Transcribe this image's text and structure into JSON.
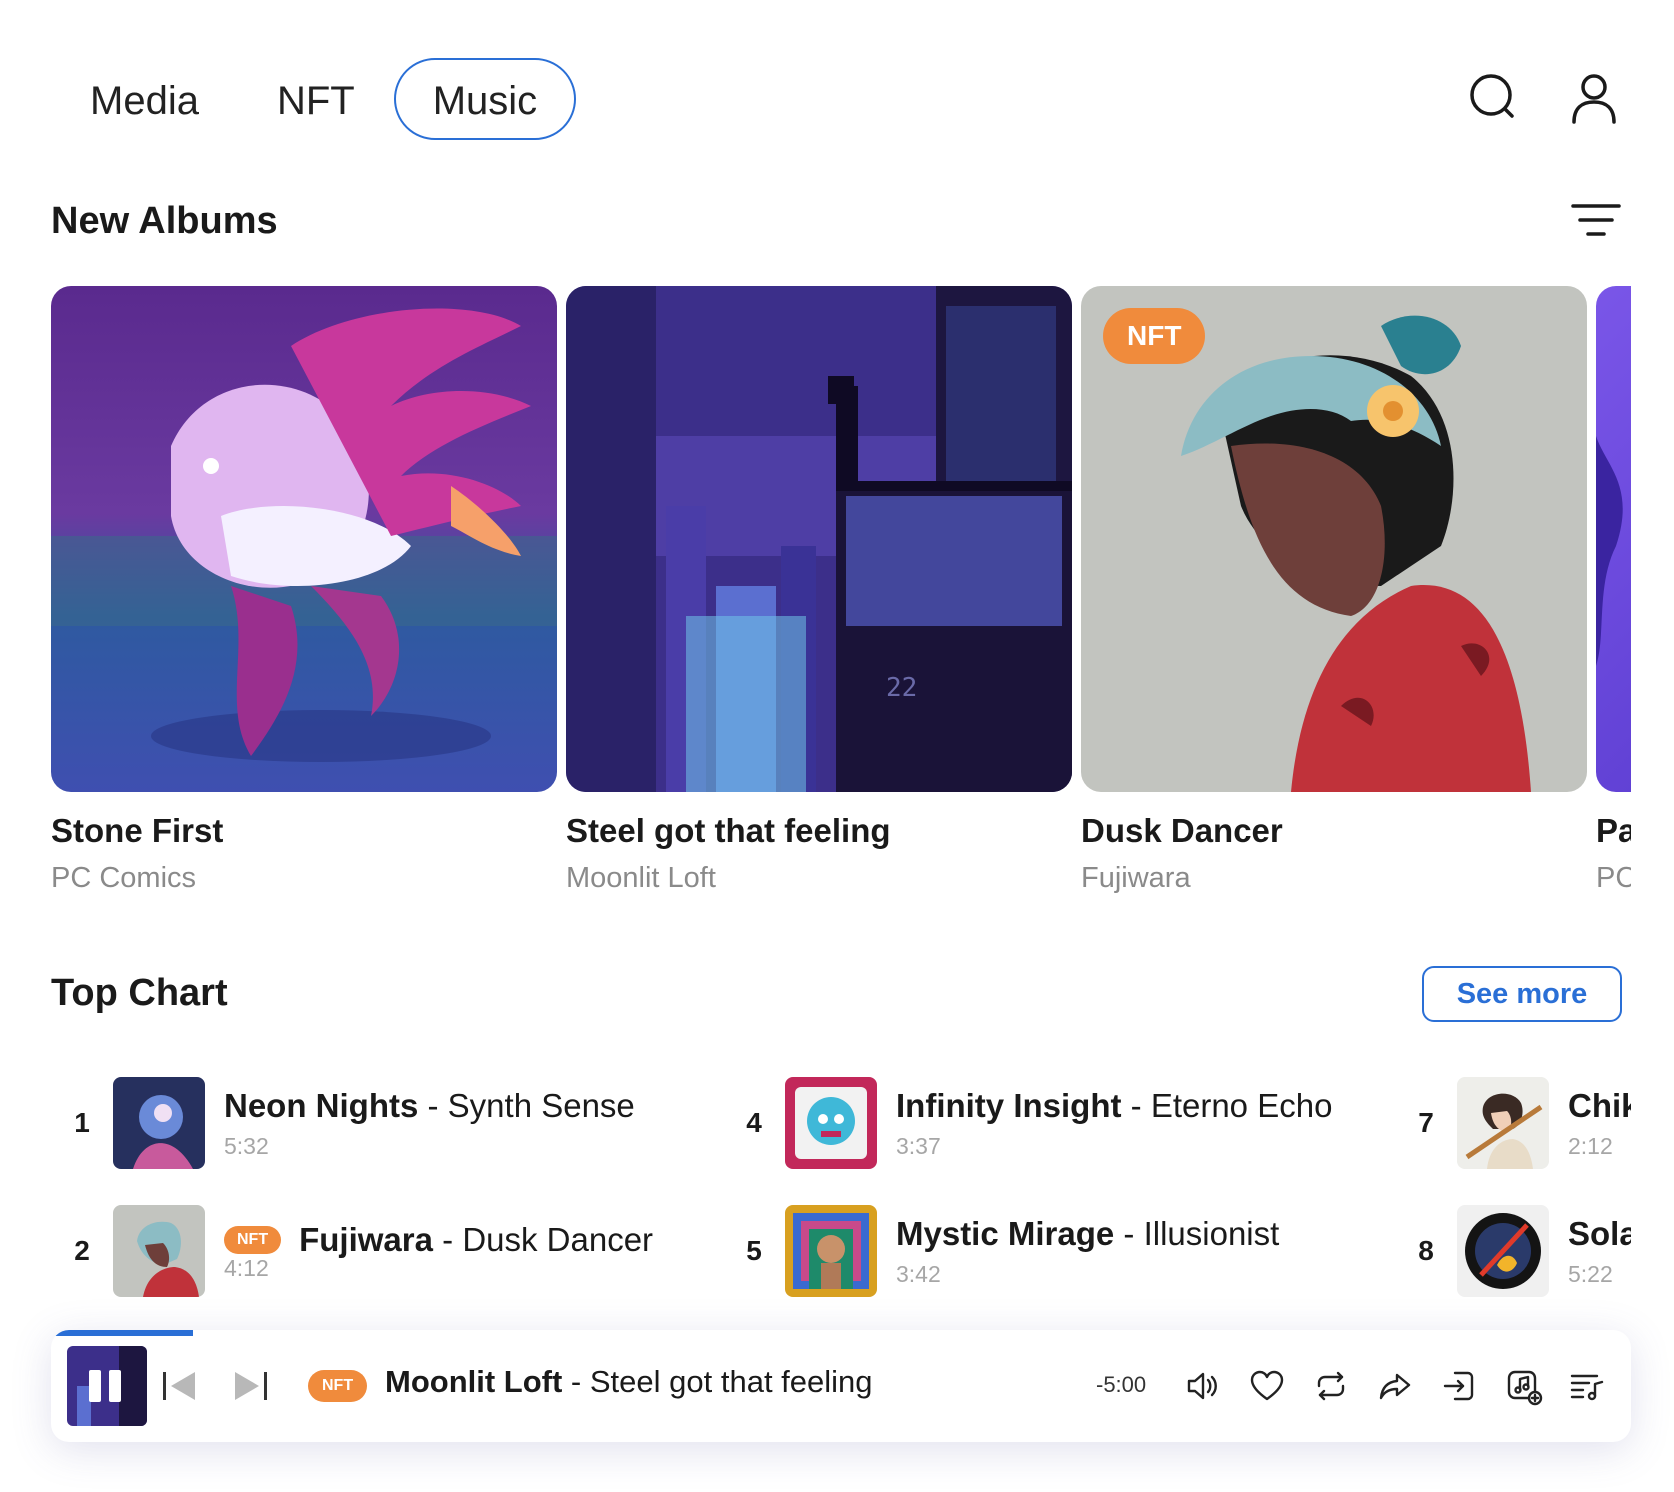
{
  "nav": {
    "tabs": [
      {
        "label": "Media"
      },
      {
        "label": "NFT"
      },
      {
        "label": "Music",
        "active": true
      }
    ]
  },
  "new_albums": {
    "title": "New Albums",
    "items": [
      {
        "title": "Stone First",
        "artist": "PC Comics"
      },
      {
        "title": "Steel got that feeling",
        "artist": "Moonlit Loft"
      },
      {
        "title": "Dusk Dancer",
        "artist": "Fujiwara",
        "badge": "NFT"
      },
      {
        "title": "Pa",
        "artist": "PC"
      }
    ]
  },
  "top_chart": {
    "title": "Top Chart",
    "see_more": "See more",
    "items": [
      {
        "rank": "1",
        "title": "Neon Nights",
        "sep": " - ",
        "artist": "Synth Sense",
        "duration": "5:32"
      },
      {
        "rank": "2",
        "title": "Fujiwara",
        "sep": " - ",
        "artist": "Dusk Dancer",
        "duration": "4:12",
        "badge": "NFT"
      },
      {
        "rank": "4",
        "title": "Infinity Insight",
        "sep": " - ",
        "artist": "Eterno Echo",
        "duration": "3:37"
      },
      {
        "rank": "5",
        "title": "Mystic Mirage",
        "sep": " - ",
        "artist": "Illusionist",
        "duration": "3:42"
      },
      {
        "rank": "7",
        "title": "Chik",
        "sep": "",
        "artist": "",
        "duration": "2:12"
      },
      {
        "rank": "8",
        "title": "Sola",
        "sep": "",
        "artist": "",
        "duration": "5:22"
      }
    ]
  },
  "player": {
    "badge": "NFT",
    "artist": "Moonlit Loft",
    "sep": " - ",
    "title": "Steel got that feeling",
    "remaining": "-5:00",
    "progress": 0.09
  },
  "colors": {
    "accent": "#2a6fd6",
    "nft_badge": "#f08b3c"
  },
  "icons": [
    "search-icon",
    "user-icon",
    "filter-icon",
    "pause-icon",
    "skip-back-icon",
    "skip-forward-icon",
    "volume-icon",
    "heart-icon",
    "repeat-icon",
    "share-icon",
    "exit-icon",
    "music-add-icon",
    "playlist-icon"
  ]
}
